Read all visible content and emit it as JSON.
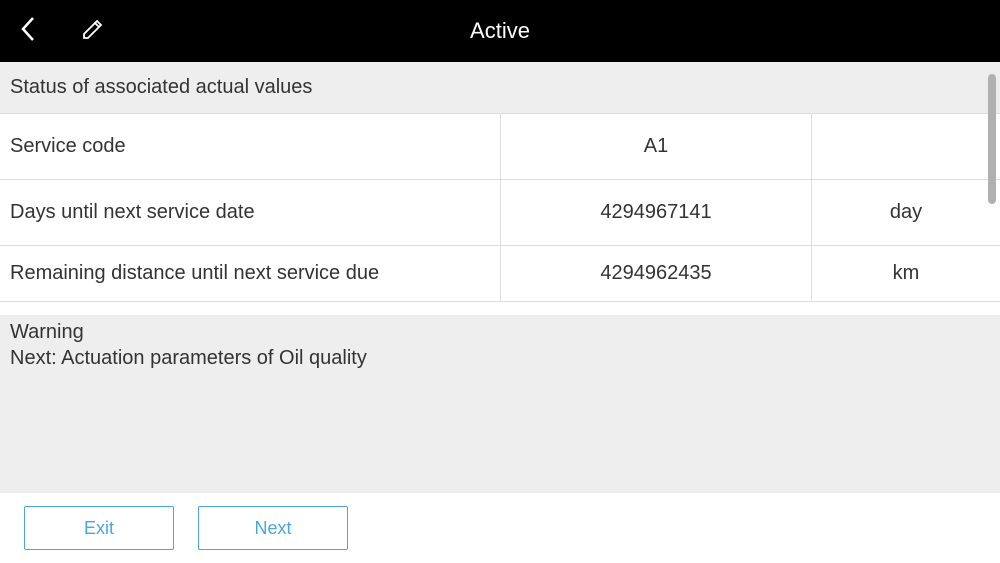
{
  "header": {
    "title": "Active"
  },
  "section": {
    "title": "Status of associated actual values"
  },
  "rows": [
    {
      "label": "Service code",
      "value": "A1",
      "unit": ""
    },
    {
      "label": "Days until next service date",
      "value": "4294967141",
      "unit": "day"
    },
    {
      "label": "Remaining distance until next service due",
      "value": "4294962435",
      "unit": "km"
    }
  ],
  "info": {
    "line1": "Warning",
    "line2": " Next: Actuation parameters of Oil quality"
  },
  "footer": {
    "exit_label": "Exit",
    "next_label": "Next"
  }
}
